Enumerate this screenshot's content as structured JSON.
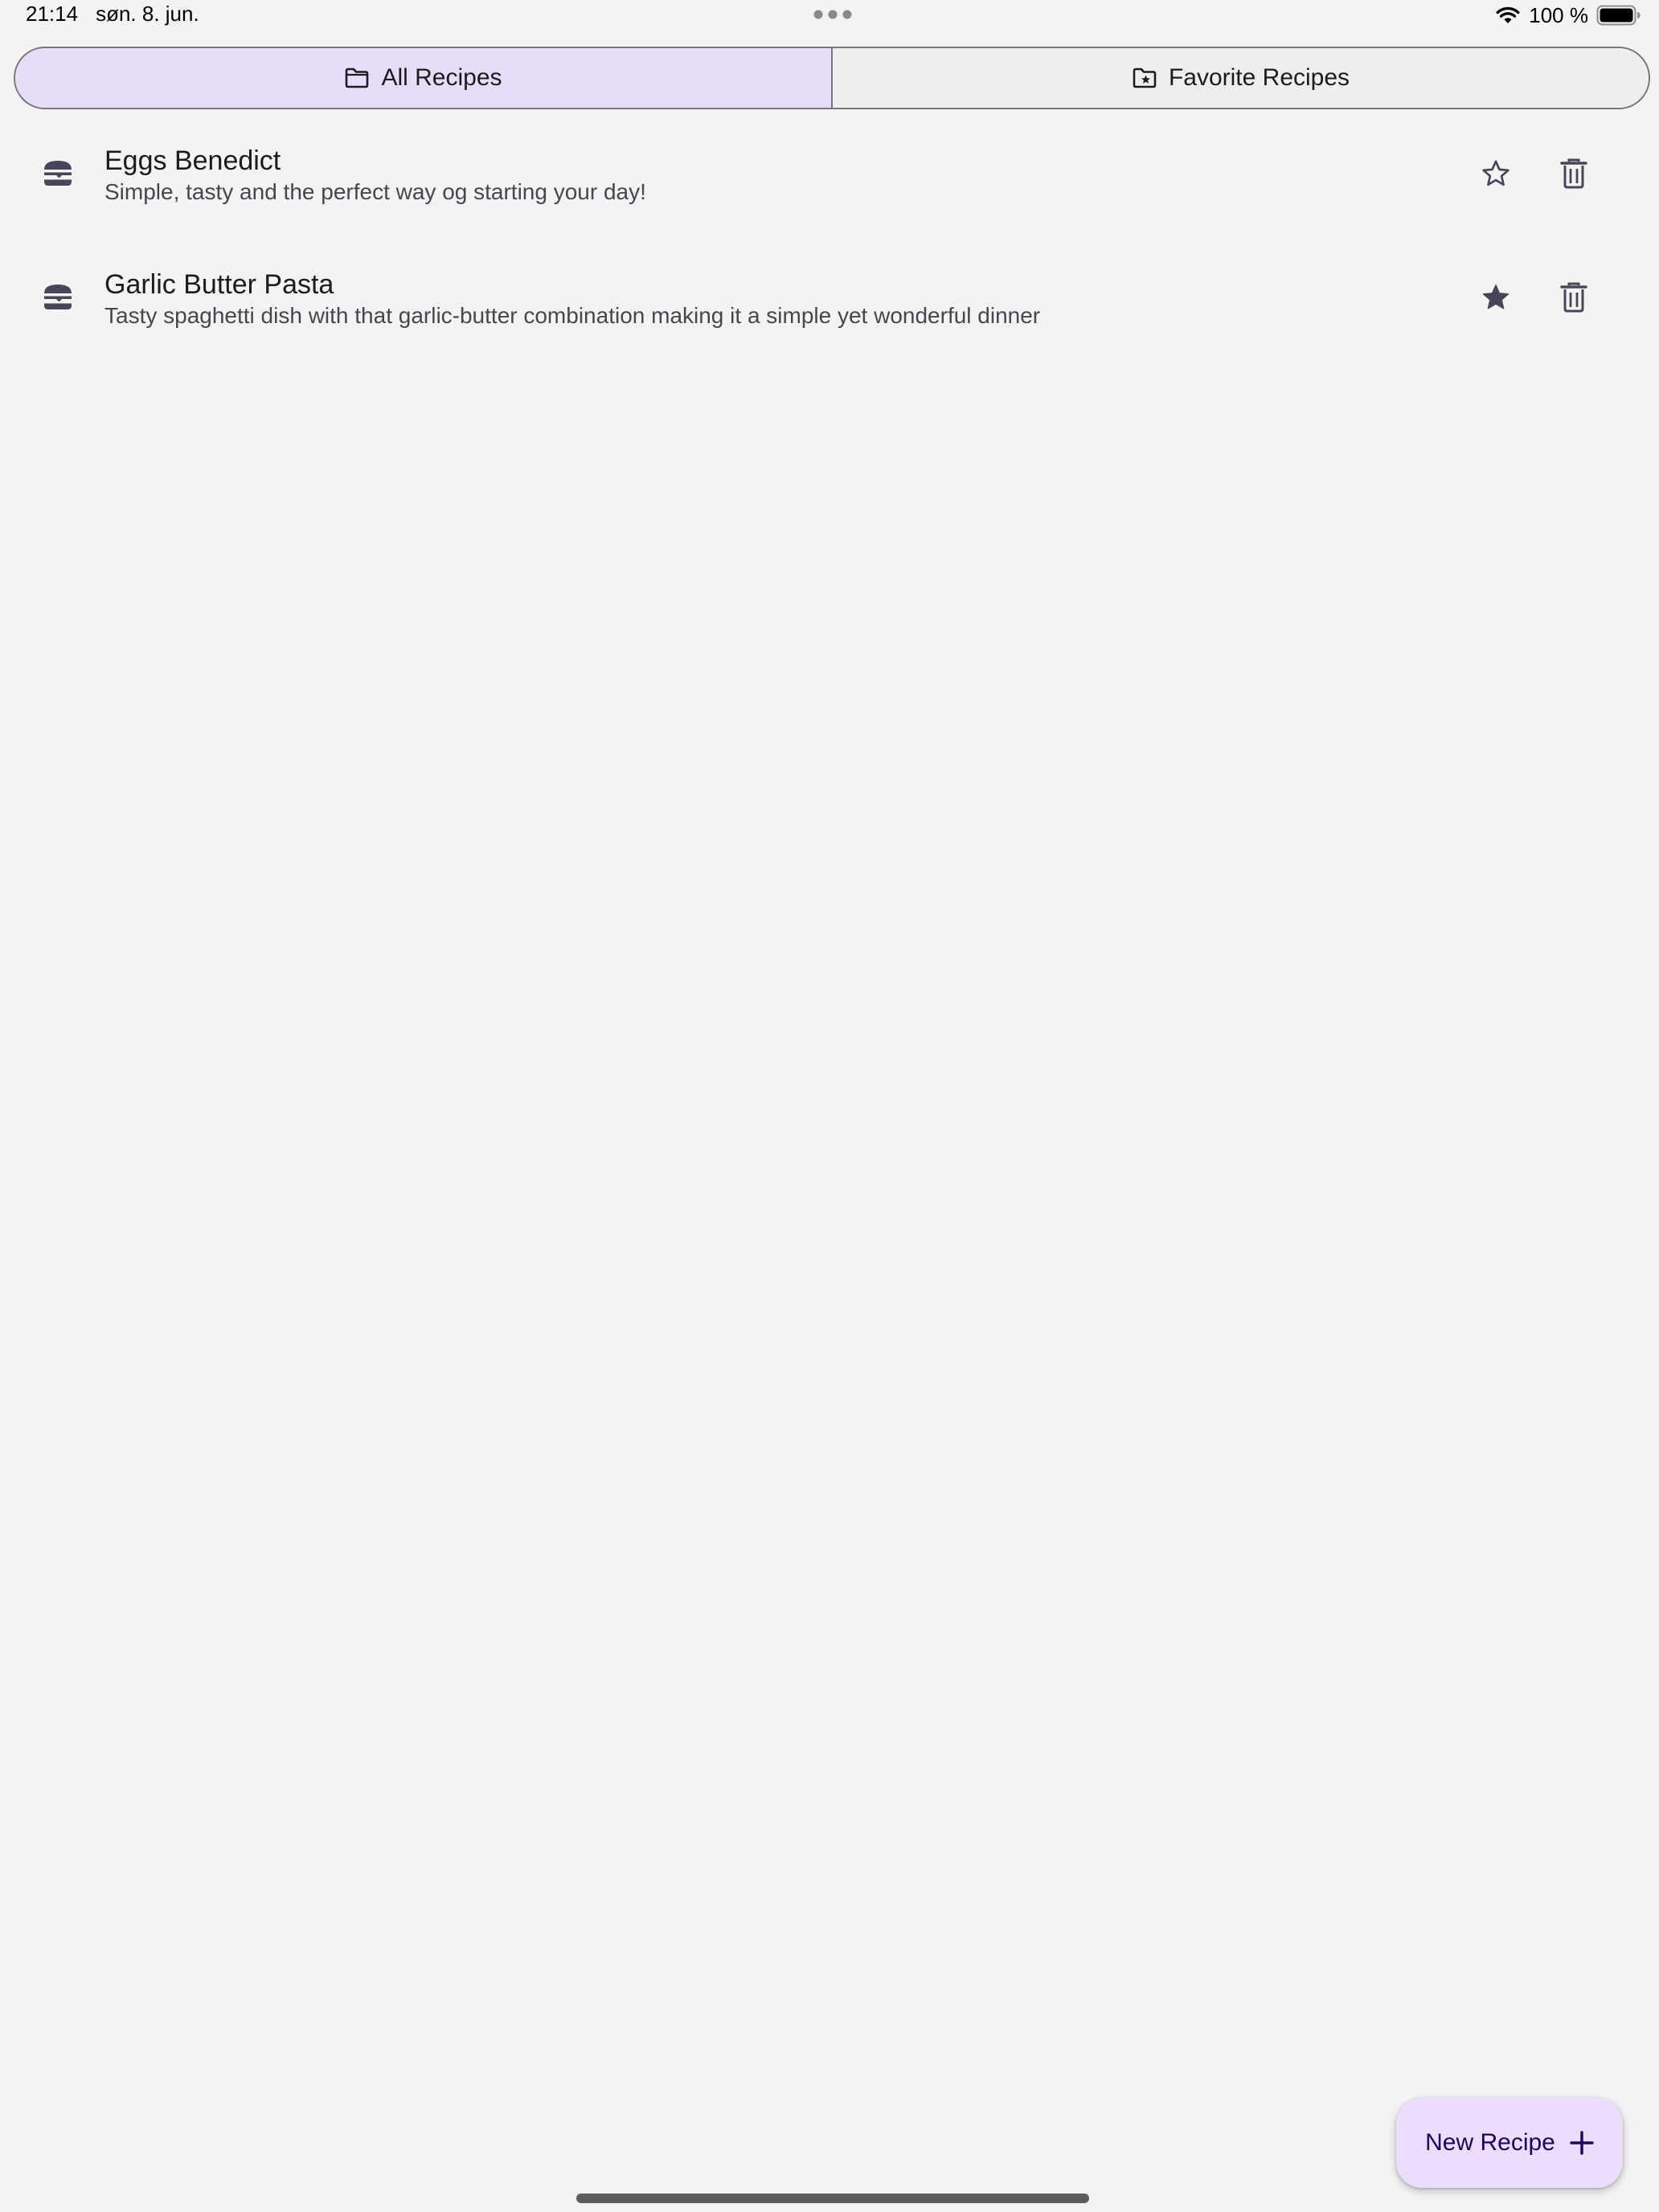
{
  "status_bar": {
    "time": "21:14",
    "date": "søn. 8. jun.",
    "battery": "100 %",
    "icons": [
      "wifi-icon",
      "battery-icon",
      "multitask-dots-icon"
    ]
  },
  "tabs": [
    {
      "label": "All Recipes",
      "icon": "folder-icon",
      "selected": true
    },
    {
      "label": "Favorite Recipes",
      "icon": "folder-star-icon",
      "selected": false
    }
  ],
  "recipes": [
    {
      "title": "Eggs Benedict",
      "description": "Simple, tasty and the perfect way og starting your day!",
      "favorite": false,
      "icon": "burger-icon"
    },
    {
      "title": "Garlic Butter Pasta",
      "description": "Tasty spaghetti dish with that garlic-butter combination making it a simple yet wonderful dinner",
      "favorite": true,
      "icon": "burger-icon"
    }
  ],
  "fab": {
    "label": "New Recipe",
    "icon": "plus-icon"
  },
  "colors": {
    "background": "#f3f3f3",
    "tab_selected": "#e8ddf8",
    "fab_background": "#eaddff",
    "icon": "#4a4459"
  }
}
